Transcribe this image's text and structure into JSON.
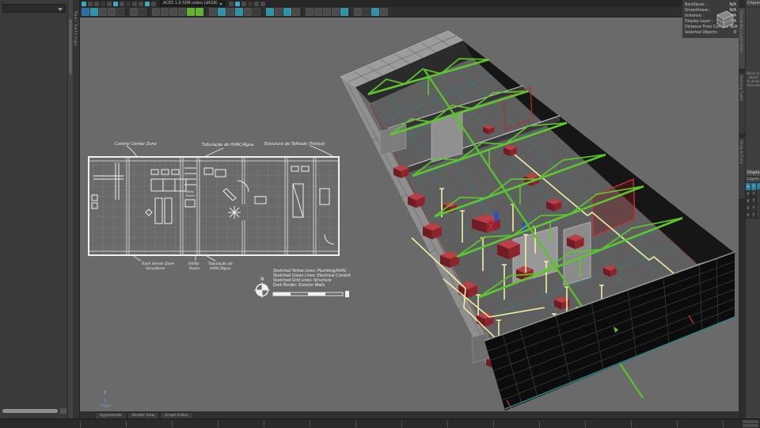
{
  "status_line": {
    "color_mgmt": "ACES 1.0 SDR-video (sRGB)"
  },
  "tool_tab": {
    "label": "Tool Settings"
  },
  "viewport": {
    "hud": {
      "rows": [
        {
          "label": "Backfaces :",
          "value": "N/A"
        },
        {
          "label": "Smoothness :",
          "value": "N/A"
        },
        {
          "label": "Instance :",
          "value": "N/A"
        },
        {
          "label": "Display Layer :",
          "value": "N/A"
        },
        {
          "label": "Distance From Camera :",
          "value": "N/A"
        },
        {
          "label": "Selected Objects :",
          "value": "0"
        }
      ]
    },
    "axis_label": "y",
    "floorplan": {
      "labels": {
        "control_zone": "Control Center Zone",
        "hvac_top": "Tubulação de HVAC/Água",
        "roof": "Estrutura do Telhado (Treliça)",
        "rack1": "Rack Server Zone",
        "rack2": "Servidores",
        "utility1": "Utility",
        "utility2": "Room",
        "hvac_b1": "Tubulação de",
        "hvac_b2": "HVAC/Água",
        "room_utility1": "Utility",
        "room_utility2": "Room",
        "compass": "N"
      },
      "legend": [
        "Sketched Yellow Lines: Plumbing/HVAC",
        "Sketched Green Lines: Electrical Conduit",
        "Sketched Grid Lines: Structure",
        "Dark Border: Exterior Walls"
      ]
    }
  },
  "right_panel": {
    "menu": "Channels",
    "tabs": [
      "Channel Box / Layer Editor",
      "Modeling Toolkit",
      "Attribute Editor"
    ],
    "hint1": "Select an object",
    "hint2": "to show channels",
    "display_header": "Display",
    "layers_menu": "Layers",
    "layer_v": "V",
    "layer_t": "T"
  },
  "bottom_bar": {
    "tabs": [
      "Hypershade",
      "Render View",
      "Graph Editor"
    ]
  },
  "colors": {
    "accent": "#49b0c4",
    "truss_green": "#5fc72e",
    "plumbing_yellow": "#eef0a2",
    "furniture_red": "#b84046",
    "grid_teal": "#2e8486"
  }
}
